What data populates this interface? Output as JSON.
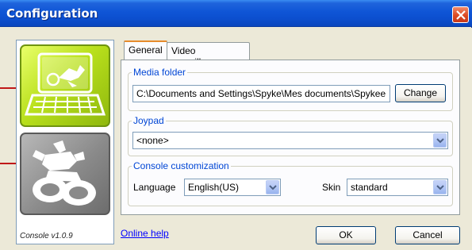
{
  "window": {
    "title": "Configuration"
  },
  "left_panel": {
    "version": "Console v1.0.9",
    "tiles": [
      "console-mode-tile",
      "robot-mode-tile"
    ]
  },
  "tabs": [
    {
      "label": "General",
      "active": true
    },
    {
      "label": "Video surveillance",
      "active": false
    }
  ],
  "media_folder": {
    "legend": "Media folder",
    "path": "C:\\Documents and Settings\\Spyke\\Mes documents\\Spykee",
    "change_label": "Change"
  },
  "joypad": {
    "legend": "Joypad",
    "selected": "<none>"
  },
  "console_customization": {
    "legend": "Console customization",
    "language_label": "Language",
    "language_value": "English(US)",
    "skin_label": "Skin",
    "skin_value": "standard"
  },
  "footer": {
    "help_link": "Online help",
    "ok_label": "OK",
    "cancel_label": "Cancel"
  },
  "colors": {
    "titlebar": "#0c4fcf",
    "accent_link": "#0046d5",
    "console_tile": "#b9e01c",
    "robot_tile": "#8a8a8a",
    "pointer": "#c01818"
  }
}
